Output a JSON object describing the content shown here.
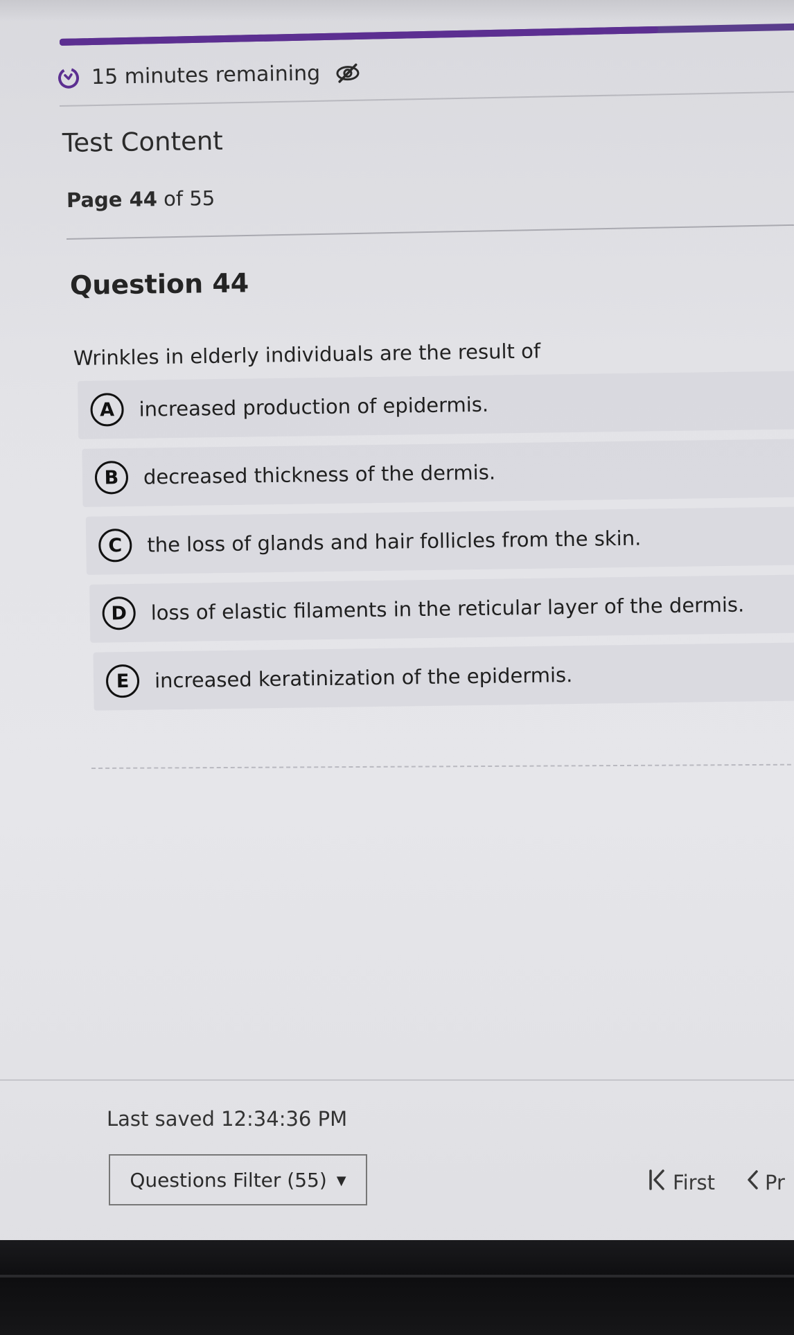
{
  "timer": {
    "text": "15 minutes remaining",
    "icon": "timer-icon",
    "toggle_icon": "eye-slash-icon"
  },
  "progress": {
    "fraction": 0.8,
    "color": "#5c2f91"
  },
  "section": {
    "title": "Test Content"
  },
  "page": {
    "label_prefix": "Page",
    "current": "44",
    "separator": "of",
    "total": "55"
  },
  "question": {
    "title": "Question 44",
    "text": "Wrinkles in elderly individuals are the result of",
    "options": [
      {
        "letter": "A",
        "text": "increased production of epidermis."
      },
      {
        "letter": "B",
        "text": "decreased thickness of the dermis."
      },
      {
        "letter": "C",
        "text": "the loss of glands and hair follicles from the skin."
      },
      {
        "letter": "D",
        "text": "loss of elastic filaments in the reticular layer of the dermis."
      },
      {
        "letter": "E",
        "text": "increased keratinization of the epidermis."
      }
    ]
  },
  "footer": {
    "last_saved": "Last saved 12:34:36 PM",
    "filter_label": "Questions Filter (55)",
    "first_label": "First",
    "prev_label": "Pr"
  }
}
